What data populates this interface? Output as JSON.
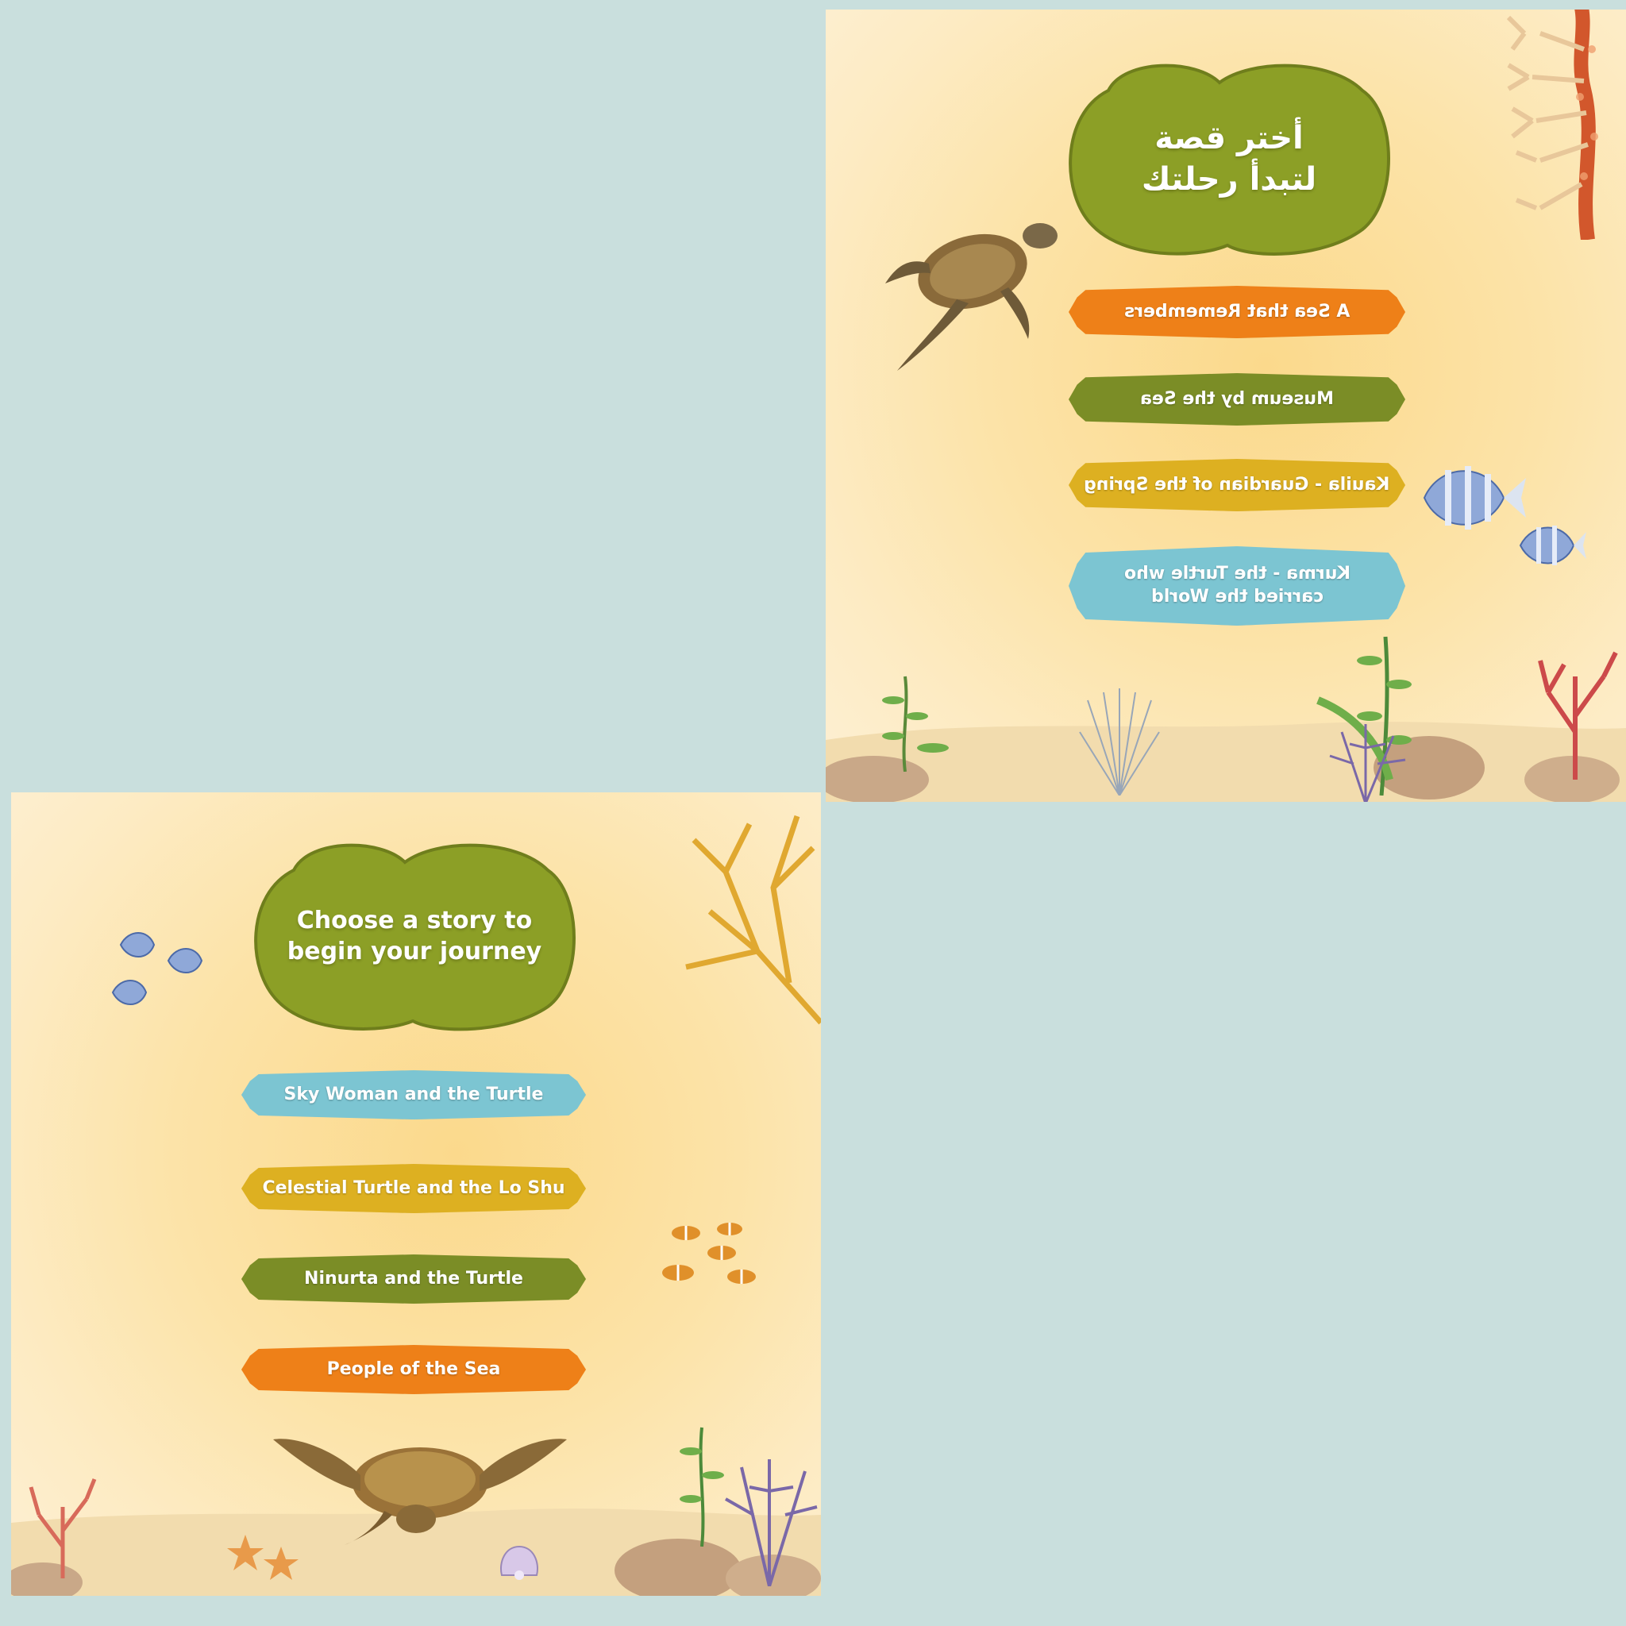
{
  "panels": {
    "top_right": {
      "title": "أختر قصة\nلتبدأ رحلتك",
      "buttons": [
        {
          "label": "A Sea that Remembers",
          "color": "#ee8018"
        },
        {
          "label": "Museum by the Sea",
          "color": "#7b8d26"
        },
        {
          "label": "Kauila - Guardian of the Spring",
          "color": "#ddb021"
        },
        {
          "label": "Kurma - the Turtle who\ncarried the World",
          "color": "#7cc5d2"
        }
      ]
    },
    "bottom_left": {
      "title": "Choose a story to\nbegin your journey",
      "buttons": [
        {
          "label": "Sky Woman and the Turtle",
          "color": "#7cc5d2"
        },
        {
          "label": "Celestial Turtle and the Lo Shu",
          "color": "#ddb021"
        },
        {
          "label": "Ninurta and the Turtle",
          "color": "#7b8d26"
        },
        {
          "label": "People of the Sea",
          "color": "#ee8018"
        }
      ]
    }
  },
  "colors": {
    "background": "#c9dfdd",
    "cloud": "#8c9f26",
    "sand": "#f2dcae"
  },
  "icons": [
    "sea-turtle-icon",
    "angelfish-icon",
    "clownfish-icon",
    "coral-icon",
    "seaweed-icon",
    "rock-icon",
    "starfish-icon",
    "shell-icon"
  ]
}
